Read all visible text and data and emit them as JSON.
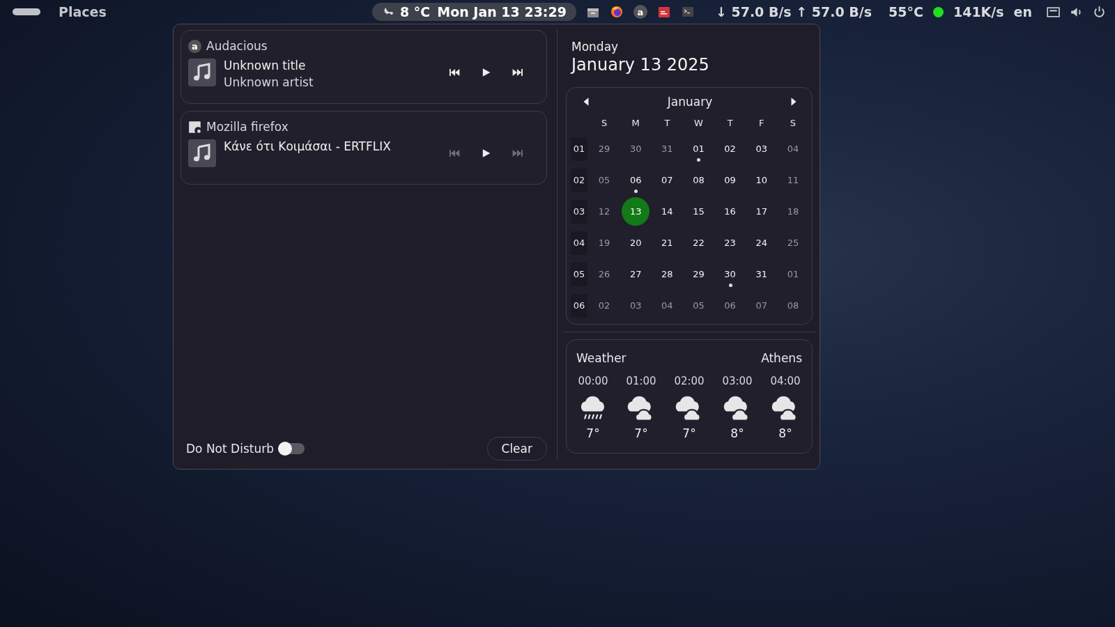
{
  "top_bar": {
    "launcher_label": "Places",
    "weather_temp": "8 °C",
    "clock": "Mon Jan 13 23:29",
    "tray": [
      {
        "kind": "files"
      },
      {
        "kind": "browser"
      },
      {
        "kind": "letter",
        "text": "a"
      },
      {
        "kind": "app"
      },
      {
        "kind": "terminal"
      }
    ],
    "network_speed": "↓ 57.0 B/s ↑ 57.0 B/s",
    "cpu_temp": "55°C",
    "status": {
      "color": "#22dd22"
    },
    "disk_speed": "141K/s",
    "keyboard_layout": "en"
  },
  "players": [
    {
      "app": "Audacious",
      "app_icon": {
        "kind": "letter",
        "text": "a"
      },
      "title": "Unknown title",
      "artist": "Unknown artist",
      "prev_enabled": true,
      "next_enabled": true
    },
    {
      "app": "Mozilla firefox",
      "app_icon": {
        "kind": "generic"
      },
      "title": "Κάνε ότι Κοιμάσαι - ERTFLIX",
      "prev_enabled": false,
      "next_enabled": false
    }
  ],
  "do_not_disturb": {
    "label": "Do Not Disturb",
    "on": false
  },
  "clear_button": "Clear",
  "date": {
    "weekday": "Monday",
    "full": "January 13 2025"
  },
  "calendar": {
    "month": "January",
    "weekdays": [
      "S",
      "M",
      "T",
      "W",
      "T",
      "F",
      "S"
    ],
    "weeks": [
      {
        "number": "01",
        "days": [
          {
            "day": "29",
            "muted": true,
            "selected": false,
            "marked": false
          },
          {
            "day": "30",
            "muted": true,
            "selected": false,
            "marked": false
          },
          {
            "day": "31",
            "muted": true,
            "selected": false,
            "marked": false
          },
          {
            "day": "01",
            "muted": false,
            "selected": false,
            "marked": true
          },
          {
            "day": "02",
            "muted": false,
            "selected": false,
            "marked": false
          },
          {
            "day": "03",
            "muted": false,
            "selected": false,
            "marked": false
          },
          {
            "day": "04",
            "muted": true,
            "selected": false,
            "marked": false
          }
        ]
      },
      {
        "number": "02",
        "days": [
          {
            "day": "05",
            "muted": true,
            "selected": false,
            "marked": false
          },
          {
            "day": "06",
            "muted": false,
            "selected": false,
            "marked": true
          },
          {
            "day": "07",
            "muted": false,
            "selected": false,
            "marked": false
          },
          {
            "day": "08",
            "muted": false,
            "selected": false,
            "marked": false
          },
          {
            "day": "09",
            "muted": false,
            "selected": false,
            "marked": false
          },
          {
            "day": "10",
            "muted": false,
            "selected": false,
            "marked": false
          },
          {
            "day": "11",
            "muted": true,
            "selected": false,
            "marked": false
          }
        ]
      },
      {
        "number": "03",
        "days": [
          {
            "day": "12",
            "muted": true,
            "selected": false,
            "marked": false
          },
          {
            "day": "13",
            "muted": false,
            "selected": true,
            "marked": false
          },
          {
            "day": "14",
            "muted": false,
            "selected": false,
            "marked": false
          },
          {
            "day": "15",
            "muted": false,
            "selected": false,
            "marked": false
          },
          {
            "day": "16",
            "muted": false,
            "selected": false,
            "marked": false
          },
          {
            "day": "17",
            "muted": false,
            "selected": false,
            "marked": false
          },
          {
            "day": "18",
            "muted": true,
            "selected": false,
            "marked": false
          }
        ]
      },
      {
        "number": "04",
        "days": [
          {
            "day": "19",
            "muted": true,
            "selected": false,
            "marked": false
          },
          {
            "day": "20",
            "muted": false,
            "selected": false,
            "marked": false
          },
          {
            "day": "21",
            "muted": false,
            "selected": false,
            "marked": false
          },
          {
            "day": "22",
            "muted": false,
            "selected": false,
            "marked": false
          },
          {
            "day": "23",
            "muted": false,
            "selected": false,
            "marked": false
          },
          {
            "day": "24",
            "muted": false,
            "selected": false,
            "marked": false
          },
          {
            "day": "25",
            "muted": true,
            "selected": false,
            "marked": false
          }
        ]
      },
      {
        "number": "05",
        "days": [
          {
            "day": "26",
            "muted": true,
            "selected": false,
            "marked": false
          },
          {
            "day": "27",
            "muted": false,
            "selected": false,
            "marked": false
          },
          {
            "day": "28",
            "muted": false,
            "selected": false,
            "marked": false
          },
          {
            "day": "29",
            "muted": false,
            "selected": false,
            "marked": false
          },
          {
            "day": "30",
            "muted": false,
            "selected": false,
            "marked": true
          },
          {
            "day": "31",
            "muted": false,
            "selected": false,
            "marked": false
          },
          {
            "day": "01",
            "muted": true,
            "selected": false,
            "marked": false
          }
        ]
      },
      {
        "number": "06",
        "days": [
          {
            "day": "02",
            "muted": true,
            "selected": false,
            "marked": false
          },
          {
            "day": "03",
            "muted": true,
            "selected": false,
            "marked": false
          },
          {
            "day": "04",
            "muted": true,
            "selected": false,
            "marked": false
          },
          {
            "day": "05",
            "muted": true,
            "selected": false,
            "marked": false
          },
          {
            "day": "06",
            "muted": true,
            "selected": false,
            "marked": false
          },
          {
            "day": "07",
            "muted": true,
            "selected": false,
            "marked": false
          },
          {
            "day": "08",
            "muted": true,
            "selected": false,
            "marked": false
          }
        ]
      }
    ]
  },
  "weather": {
    "title": "Weather",
    "city": "Athens",
    "hours": [
      {
        "time": "00:00",
        "kind": "rain",
        "temp": "7°"
      },
      {
        "time": "01:00",
        "kind": "cloudy",
        "temp": "7°"
      },
      {
        "time": "02:00",
        "kind": "cloudy",
        "temp": "7°"
      },
      {
        "time": "03:00",
        "kind": "cloudy",
        "temp": "8°"
      },
      {
        "time": "04:00",
        "kind": "cloudy",
        "temp": "8°"
      }
    ]
  }
}
